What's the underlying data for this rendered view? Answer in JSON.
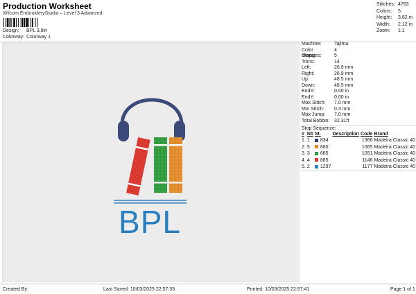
{
  "header": {
    "title": "Production Worksheet",
    "subtitle": "Wilcom EmbroideryStudio – Level 3 Advanced",
    "design_label": "Design:",
    "design_value": "BPL 3,8in",
    "colorway_label": "Colorway:",
    "colorway_value": "Colorway 1"
  },
  "summary": [
    {
      "label": "Stitches:",
      "value": "4783"
    },
    {
      "label": "Colors:",
      "value": "5"
    },
    {
      "label": "Height:",
      "value": "3.82 in"
    },
    {
      "label": "Width:",
      "value": "2.12 in"
    },
    {
      "label": "Zoom:",
      "value": "1:1"
    }
  ],
  "details": [
    {
      "label": "Machine:",
      "value": "Tajima"
    },
    {
      "label": "Color changes:",
      "value": "4"
    },
    {
      "label": "Stops:",
      "value": "5"
    },
    {
      "label": "Trims:",
      "value": "14"
    },
    {
      "label": "Left:",
      "value": "26.9 mm"
    },
    {
      "label": "Right:",
      "value": "26.9 mm"
    },
    {
      "label": "Up:",
      "value": "48.5 mm"
    },
    {
      "label": "Down:",
      "value": "48.5 mm"
    },
    {
      "label": "EndX:",
      "value": "0.00 in"
    },
    {
      "label": "EndY:",
      "value": "0.00 in"
    },
    {
      "label": "Max Stitch:",
      "value": "7.0 mm"
    },
    {
      "label": "Min Stitch:",
      "value": "0.3 mm"
    },
    {
      "label": "Max Jump:",
      "value": "7.0 mm"
    },
    {
      "label": "Total Bobbin:",
      "value": "32.31ft"
    }
  ],
  "stop_sequence": {
    "title": "Stop Sequence:",
    "headers": {
      "stop": "#",
      "needle": "N#",
      "st": "St.",
      "desc": "Description",
      "code": "Code",
      "brand": "Brand"
    },
    "rows": [
      {
        "stop": "1.",
        "needle": "1",
        "color": "#2e3f6e",
        "st": "834",
        "desc": "",
        "code": "1366",
        "brand": "Madeira Classic 40"
      },
      {
        "stop": "2.",
        "needle": "5",
        "color": "#e08a2a",
        "st": "880",
        "desc": "",
        "code": "1065",
        "brand": "Madeira Classic 40"
      },
      {
        "stop": "3.",
        "needle": "3",
        "color": "#2f9a3c",
        "st": "685",
        "desc": "",
        "code": "1051",
        "brand": "Madeira Classic 40"
      },
      {
        "stop": "4.",
        "needle": "4",
        "color": "#d9342b",
        "st": "885",
        "desc": "",
        "code": "1146",
        "brand": "Madeira Classic 40"
      },
      {
        "stop": "5.",
        "needle": "2",
        "color": "#2a7fc0",
        "st": "1297",
        "desc": "",
        "code": "1177",
        "brand": "Madeira Classic 40"
      }
    ]
  },
  "design_art": {
    "text": "BPL",
    "colors": {
      "headphones": "#3b4a78",
      "red_book": "#d9342b",
      "green_book": "#2f9a3c",
      "orange_book": "#e08a2a",
      "text": "#2a7fc0",
      "book_spine": "#ffffff"
    }
  },
  "footer": {
    "created_by": "Created By:",
    "last_saved": "Last Saved: 10/03/2025 22:57:33",
    "printed": "Printed: 10/03/2025 22:57:41",
    "page": "Page 1 of 1"
  }
}
